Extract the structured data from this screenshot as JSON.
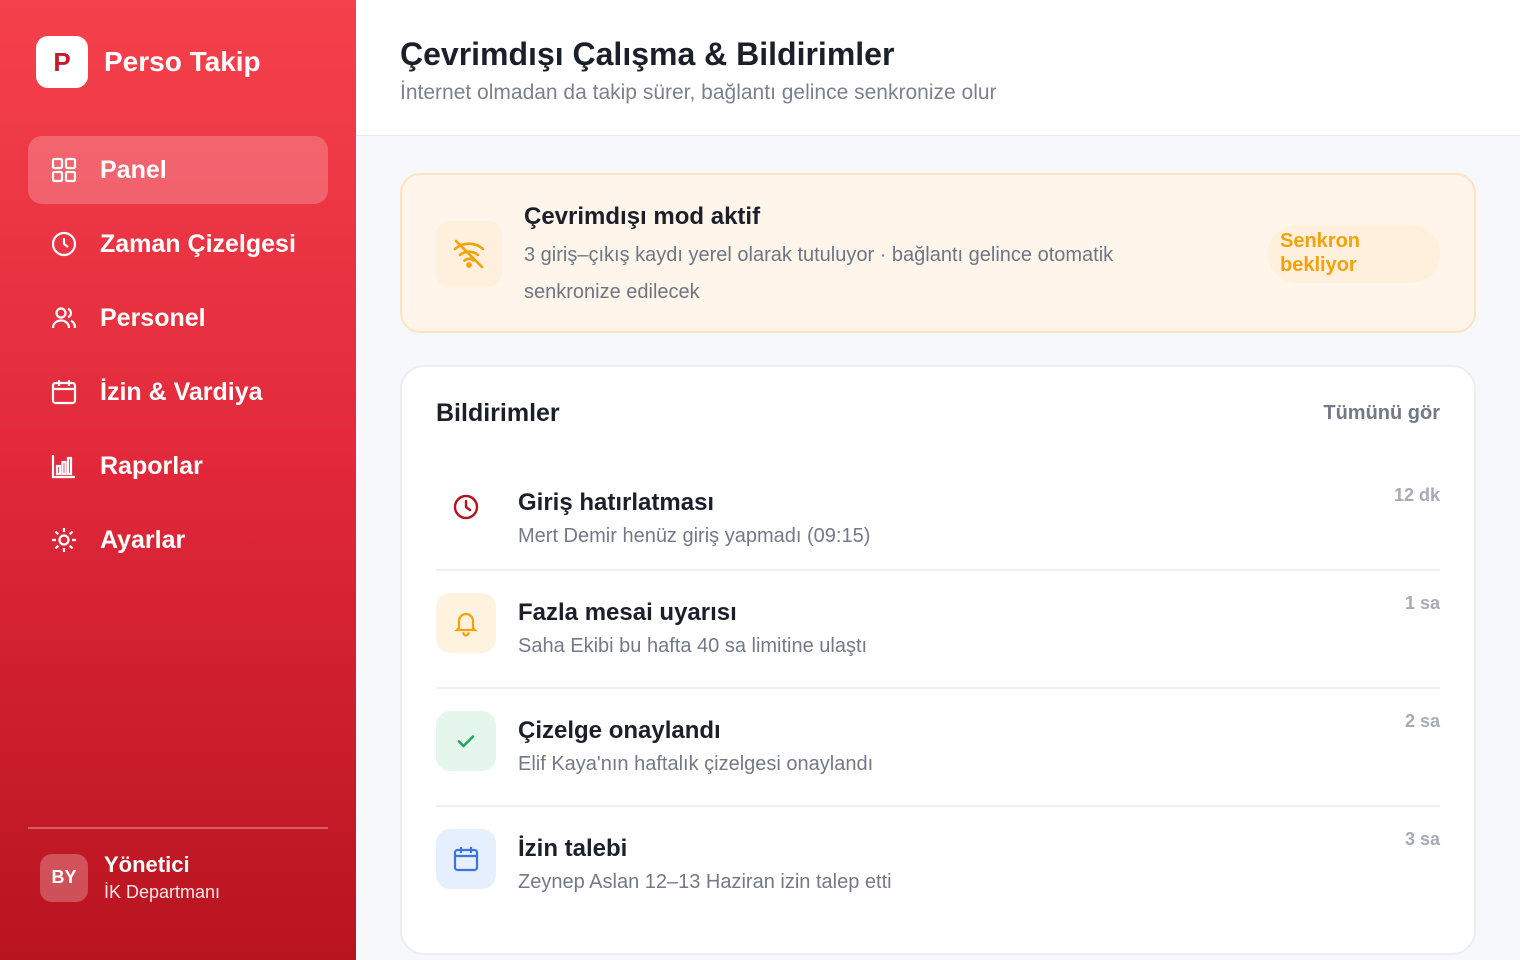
{
  "brand": {
    "logo_letter": "P",
    "name": "Perso Takip"
  },
  "sidebar": {
    "items": [
      {
        "label": "Panel",
        "icon": "grid-icon",
        "active": true
      },
      {
        "label": "Zaman Çizelgesi",
        "icon": "clock-icon"
      },
      {
        "label": "Personel",
        "icon": "users-icon"
      },
      {
        "label": "İzin & Vardiya",
        "icon": "calendar-icon"
      },
      {
        "label": "Raporlar",
        "icon": "bar-chart-icon"
      },
      {
        "label": "Ayarlar",
        "icon": "gear-icon"
      }
    ],
    "user": {
      "initials": "BY",
      "name": "Yönetici",
      "department": "İK Departmanı"
    }
  },
  "header": {
    "title": "Çevrimdışı Çalışma & Bildirimler",
    "subtitle": "İnternet olmadan da takip sürer, bağlantı gelince senkronize olur"
  },
  "offline": {
    "icon": "wifi-off-icon",
    "title": "Çevrimdışı mod aktif",
    "text": "3 giriş–çıkış kaydı yerel olarak tutuluyor · bağlantı gelince otomatik senkronize edilecek",
    "badge": "Senkron bekliyor"
  },
  "notifications": {
    "heading": "Bildirimler",
    "see_all": "Tümünü gör",
    "items": [
      {
        "icon": "clock-icon",
        "title": "Giriş hatırlatması",
        "desc": "Mert Demir henüz giriş yapmadı (09:15)",
        "time": "12 dk"
      },
      {
        "icon": "bell-icon",
        "title": "Fazla mesai uyarısı",
        "desc": "Saha Ekibi bu hafta 40 sa limitine ulaştı",
        "time": "1 sa"
      },
      {
        "icon": "check-icon",
        "title": "Çizelge onaylandı",
        "desc": "Elif Kaya'nın haftalık çizelgesi onaylandı",
        "time": "2 sa"
      },
      {
        "icon": "calendar-icon",
        "title": "İzin talebi",
        "desc": "Zeynep Aslan 12–13 Haziran izin talep etti",
        "time": "3 sa"
      }
    ]
  },
  "colors": {
    "brand_red": "#e0283a",
    "warning": "#f5a108",
    "success": "#22a85a",
    "info": "#3b73e0",
    "alert": "#b3141f"
  }
}
